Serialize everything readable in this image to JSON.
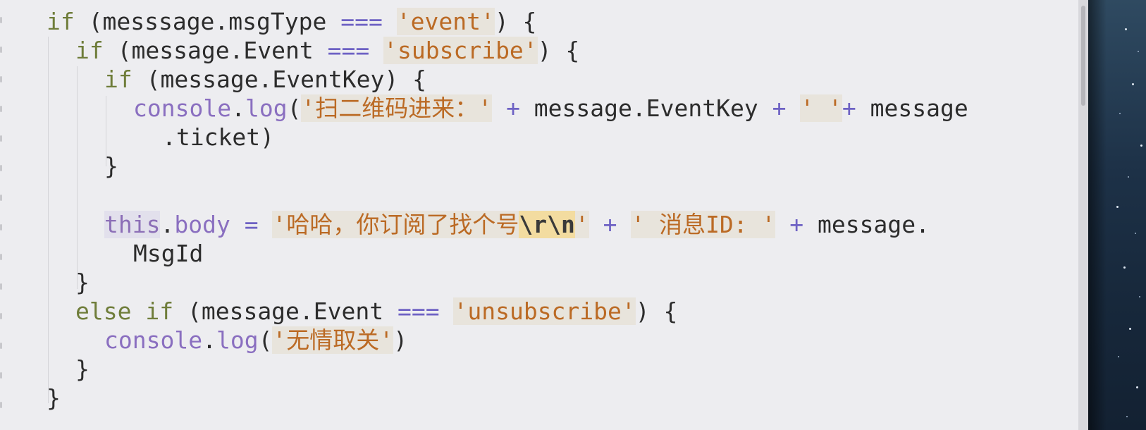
{
  "editor": {
    "lines": [
      [
        "if",
        " (messsage.msgType ",
        "===",
        " ",
        "'event'",
        ") {"
      ],
      [
        "if",
        " (message.Event ",
        "===",
        " ",
        "'subscribe'",
        ") {"
      ],
      [
        "if",
        " (message.EventKey) {"
      ],
      [
        "console",
        ".",
        "log",
        "(",
        "'扫二维码进来：'",
        " ",
        "+",
        " message.EventKey ",
        "+",
        " ",
        "' '",
        "+",
        " message"
      ],
      [
        ".ticket)"
      ],
      [
        "}"
      ],
      [
        "this",
        ".",
        "body",
        " ",
        "=",
        " ",
        "'哈哈，你订阅了找个号",
        "\\r\\n",
        "'",
        " ",
        "+",
        " ",
        "' 消息ID: '",
        " ",
        "+",
        " message."
      ],
      [
        "MsgId"
      ],
      [
        "}"
      ],
      [
        "else",
        " ",
        "if",
        " (message.Event ",
        "===",
        " ",
        "'unsubscribe'",
        ") {"
      ],
      [
        "console",
        ".",
        "log",
        "(",
        "'无情取关'",
        ")"
      ],
      [
        "}"
      ],
      [
        "}"
      ]
    ]
  },
  "colors": {
    "keyword": "#6f7d3a",
    "string": "#bb6a24",
    "operator": "#6e62c4",
    "property": "#8a6fc0",
    "escape_highlight": "#f3dca0"
  }
}
